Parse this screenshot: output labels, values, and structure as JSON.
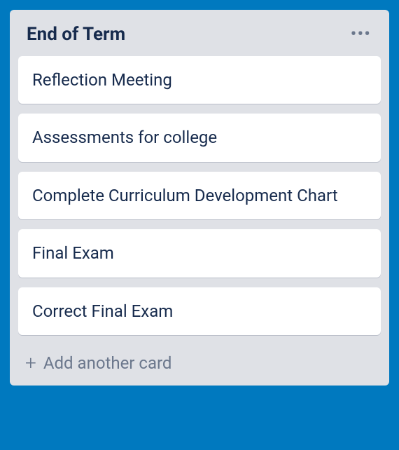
{
  "list": {
    "title": "End of Term",
    "cards": [
      {
        "title": "Reflection Meeting"
      },
      {
        "title": "Assessments for college"
      },
      {
        "title": "Complete Curriculum Development Chart"
      },
      {
        "title": "Final Exam"
      },
      {
        "title": "Correct Final Exam"
      }
    ],
    "add_card_label": "Add another card"
  }
}
